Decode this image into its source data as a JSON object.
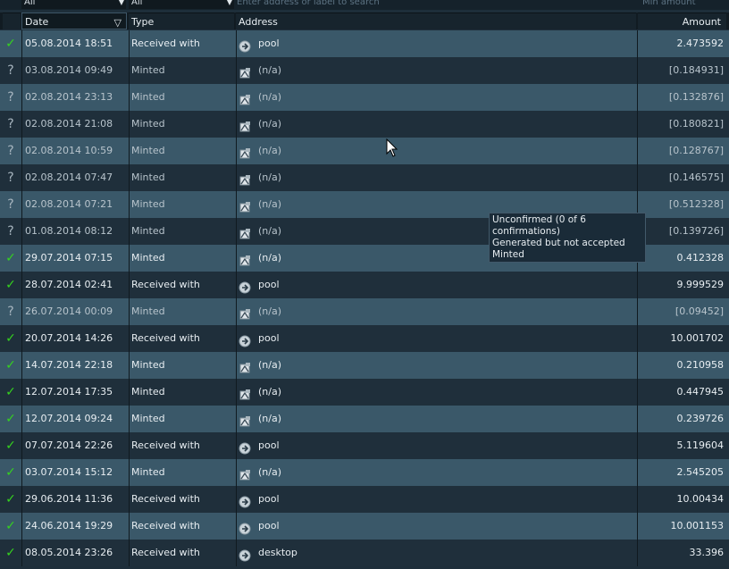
{
  "filters": {
    "date_filter": "All",
    "type_filter": "All",
    "address_placeholder": "Enter address or label to search",
    "amount_placeholder": "Min amount"
  },
  "columns": {
    "date": "Date",
    "type": "Type",
    "address": "Address",
    "amount": "Amount"
  },
  "transactions": [
    {
      "status": "confirmed",
      "date": "05.08.2014 18:51",
      "type": "Received with",
      "icon": "receive-icon",
      "address": "pool",
      "amount": "2.473592"
    },
    {
      "status": "unconfirmed",
      "date": "03.08.2014 09:49",
      "type": "Minted",
      "icon": "mint-icon",
      "address": "(n/a)",
      "amount": "[0.184931]"
    },
    {
      "status": "unconfirmed",
      "date": "02.08.2014 23:13",
      "type": "Minted",
      "icon": "mint-icon",
      "address": "(n/a)",
      "amount": "[0.132876]"
    },
    {
      "status": "unconfirmed",
      "date": "02.08.2014 21:08",
      "type": "Minted",
      "icon": "mint-icon",
      "address": "(n/a)",
      "amount": "[0.180821]"
    },
    {
      "status": "unconfirmed",
      "date": "02.08.2014 10:59",
      "type": "Minted",
      "icon": "mint-icon",
      "address": "(n/a)",
      "amount": "[0.128767]"
    },
    {
      "status": "unconfirmed",
      "date": "02.08.2014 07:47",
      "type": "Minted",
      "icon": "mint-icon",
      "address": "(n/a)",
      "amount": "[0.146575]"
    },
    {
      "status": "unconfirmed",
      "date": "02.08.2014 07:21",
      "type": "Minted",
      "icon": "mint-icon",
      "address": "(n/a)",
      "amount": "[0.512328]"
    },
    {
      "status": "unconfirmed",
      "date": "01.08.2014 08:12",
      "type": "Minted",
      "icon": "mint-icon",
      "address": "(n/a)",
      "amount": "[0.139726]"
    },
    {
      "status": "confirmed",
      "date": "29.07.2014 07:15",
      "type": "Minted",
      "icon": "mint-icon",
      "address": "(n/a)",
      "amount": "0.412328"
    },
    {
      "status": "confirmed",
      "date": "28.07.2014 02:41",
      "type": "Received with",
      "icon": "receive-icon",
      "address": "pool",
      "amount": "9.999529"
    },
    {
      "status": "unconfirmed",
      "date": "26.07.2014 00:09",
      "type": "Minted",
      "icon": "mint-icon",
      "address": "(n/a)",
      "amount": "[0.09452]"
    },
    {
      "status": "confirmed",
      "date": "20.07.2014 14:26",
      "type": "Received with",
      "icon": "receive-icon",
      "address": "pool",
      "amount": "10.001702"
    },
    {
      "status": "confirmed",
      "date": "14.07.2014 22:18",
      "type": "Minted",
      "icon": "mint-icon",
      "address": "(n/a)",
      "amount": "0.210958"
    },
    {
      "status": "confirmed",
      "date": "12.07.2014 17:35",
      "type": "Minted",
      "icon": "mint-icon",
      "address": "(n/a)",
      "amount": "0.447945"
    },
    {
      "status": "confirmed",
      "date": "12.07.2014 09:24",
      "type": "Minted",
      "icon": "mint-icon",
      "address": "(n/a)",
      "amount": "0.239726"
    },
    {
      "status": "confirmed",
      "date": "07.07.2014 22:26",
      "type": "Received with",
      "icon": "receive-icon",
      "address": "pool",
      "amount": "5.119604"
    },
    {
      "status": "confirmed",
      "date": "03.07.2014 15:12",
      "type": "Minted",
      "icon": "mint-icon",
      "address": "(n/a)",
      "amount": "2.545205"
    },
    {
      "status": "confirmed",
      "date": "29.06.2014 11:36",
      "type": "Received with",
      "icon": "receive-icon",
      "address": "pool",
      "amount": "10.00434"
    },
    {
      "status": "confirmed",
      "date": "24.06.2014 19:29",
      "type": "Received with",
      "icon": "receive-icon",
      "address": "pool",
      "amount": "10.001153"
    },
    {
      "status": "confirmed",
      "date": "08.05.2014 23:26",
      "type": "Received with",
      "icon": "receive-icon",
      "address": "desktop",
      "amount": "33.396"
    }
  ],
  "tooltip": {
    "line1": "Unconfirmed (0 of 6 confirmations)",
    "line2": "Generated but not accepted",
    "line3": "Minted"
  },
  "colors": {
    "confirmed_check": "#35d11f",
    "unconfirmed_mark": "#a7b5bf",
    "row_light": "#3a5869",
    "row_dark": "#1f2f3b"
  }
}
